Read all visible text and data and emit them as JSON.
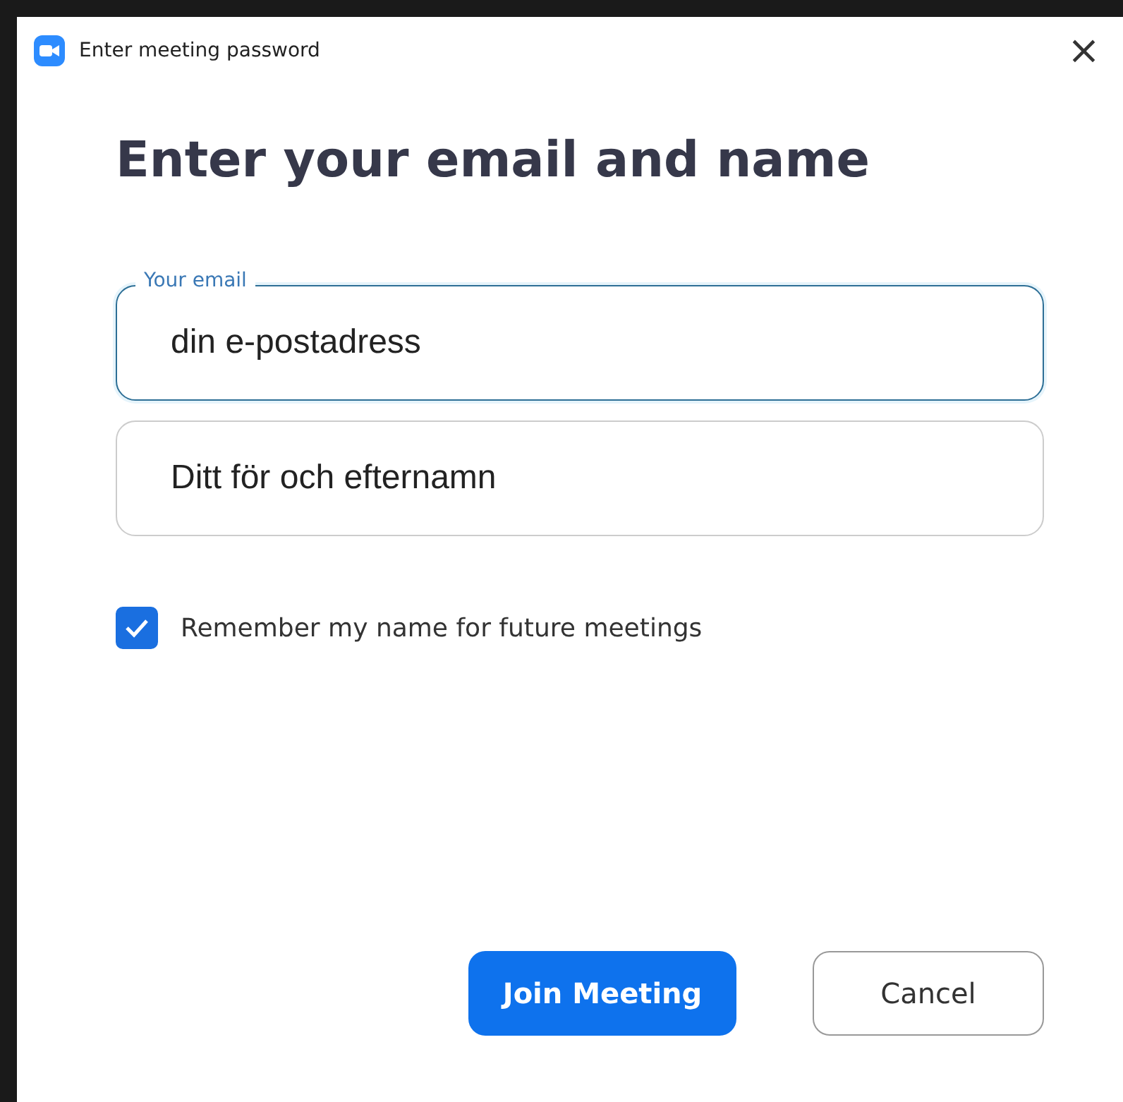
{
  "window": {
    "title": "Enter meeting password",
    "close": "×"
  },
  "heading": "Enter your email and name",
  "fields": [
    {
      "label": "Your email",
      "value": "din e-postadress",
      "focused": true
    },
    {
      "value": "Ditt för och efternamn",
      "focused": false
    }
  ],
  "remember": {
    "label": "Remember my name for future meetings",
    "checked": true
  },
  "buttons": [
    {
      "label": "Join Meeting",
      "kind": "primary"
    },
    {
      "label": "Cancel",
      "kind": "secondary"
    }
  ]
}
